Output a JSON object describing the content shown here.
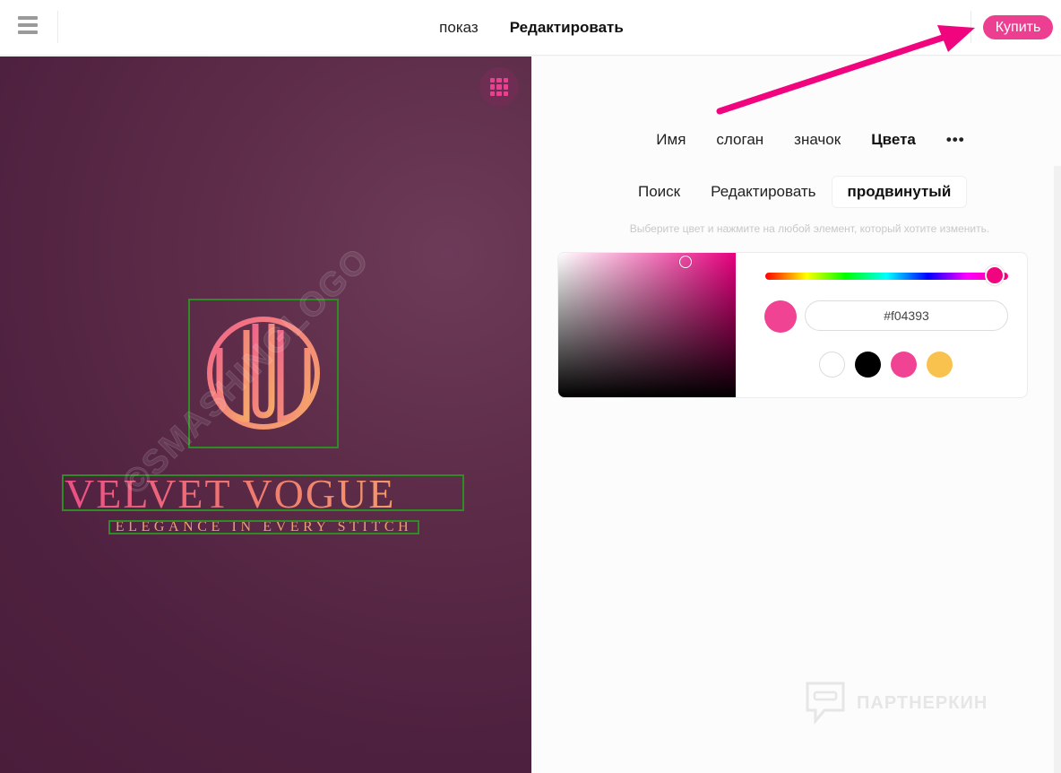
{
  "topbar": {
    "tabs": [
      {
        "label": "показ",
        "active": false
      },
      {
        "label": "Редактировать",
        "active": true
      }
    ],
    "buy_label": "Купить"
  },
  "canvas": {
    "logo_name": "VELVET VOGUE",
    "slogan": "ELEGANCE IN EVERY STITCH",
    "watermark": "©SMASHINGLOGO"
  },
  "panel": {
    "subtabs": [
      {
        "label": "Имя",
        "active": false
      },
      {
        "label": "слоган",
        "active": false
      },
      {
        "label": "значок",
        "active": false
      },
      {
        "label": "Цвета",
        "active": true
      }
    ],
    "more_label": "•••",
    "modes": [
      {
        "label": "Поиск",
        "active": false
      },
      {
        "label": "Редактировать",
        "active": false
      },
      {
        "label": "продвинутый",
        "active": true
      }
    ],
    "hint": "Выберите цвет и нажмите на любой элемент, который хотите изменить.",
    "picker": {
      "hex_value": "#f04393",
      "current_color": "#f04393",
      "presets": [
        "#ffffff",
        "#000000",
        "#f04393",
        "#f9c24f"
      ]
    }
  },
  "watermark_brand": "ПАРТНЕРКИН",
  "colors": {
    "accent": "#ec3f91",
    "canvas_bg": "#5a2a47",
    "annotation_arrow": "#f0057e",
    "selection_box": "#2f8b25"
  }
}
